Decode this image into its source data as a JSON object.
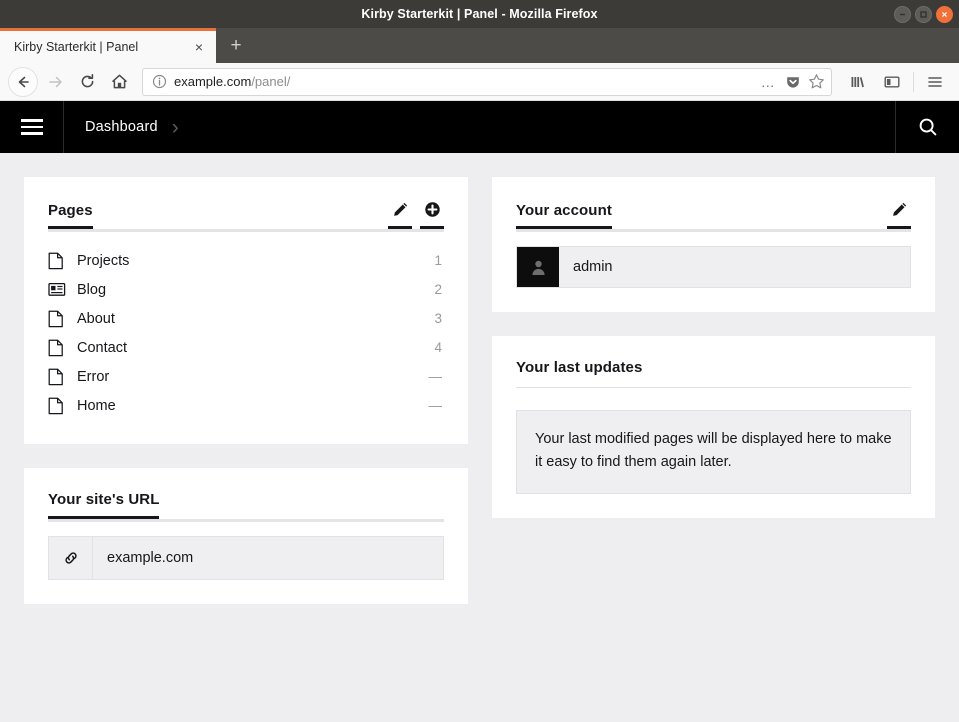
{
  "window": {
    "title": "Kirby Starterkit | Panel - Mozilla Firefox",
    "minimize_label": "–",
    "maximize_label": "□",
    "close_label": "×"
  },
  "browser": {
    "tab": {
      "title": "Kirby Starterkit | Panel",
      "close_label": "×"
    },
    "new_tab_label": "+",
    "nav": {
      "back": "back-arrow",
      "forward": "forward-arrow",
      "reload": "reload-arrow",
      "home": "home-house"
    },
    "url": {
      "host": "example.com",
      "path": "/panel/",
      "info_icon": "info-circle",
      "page_actions_label": "…",
      "pocket_icon": "pocket-shield",
      "bookmark_icon": "star-outline"
    },
    "toolbar": {
      "library_icon": "library-books",
      "sidebar_icon": "sidebar-panel",
      "menu_icon": "hamburger-menu"
    }
  },
  "panel": {
    "topbar": {
      "menu_icon": "hamburger-menu",
      "breadcrumb": "Dashboard",
      "breadcrumb_separator": "›",
      "search_icon": "search-magnifier"
    },
    "pages_card": {
      "title": "Pages",
      "edit_icon": "pencil-edit-icon",
      "add_icon": "plus-circle-icon",
      "items": [
        {
          "icon": "file-page-icon",
          "name": "Projects",
          "count": "1"
        },
        {
          "icon": "article-news-icon",
          "name": "Blog",
          "count": "2"
        },
        {
          "icon": "file-page-icon",
          "name": "About",
          "count": "3"
        },
        {
          "icon": "file-page-icon",
          "name": "Contact",
          "count": "4"
        },
        {
          "icon": "file-page-icon",
          "name": "Error",
          "count": "—"
        },
        {
          "icon": "file-page-icon",
          "name": "Home",
          "count": "—"
        }
      ]
    },
    "site_url_card": {
      "title": "Your site's URL",
      "link_icon": "chain-link-icon",
      "value": "example.com"
    },
    "account_card": {
      "title": "Your account",
      "edit_icon": "pencil-edit-icon",
      "avatar_icon": "user-avatar-icon",
      "username": "admin"
    },
    "updates_card": {
      "title": "Your last updates",
      "empty_message": "Your last modified pages will be displayed here to make it easy to find them again later."
    }
  },
  "colors": {
    "accent_orange": "#e8703a",
    "panel_black": "#000000",
    "content_bg": "#eeedf0",
    "card_bg": "#ffffff",
    "field_bg": "#efeff1",
    "muted_text": "#9a9a9e"
  }
}
